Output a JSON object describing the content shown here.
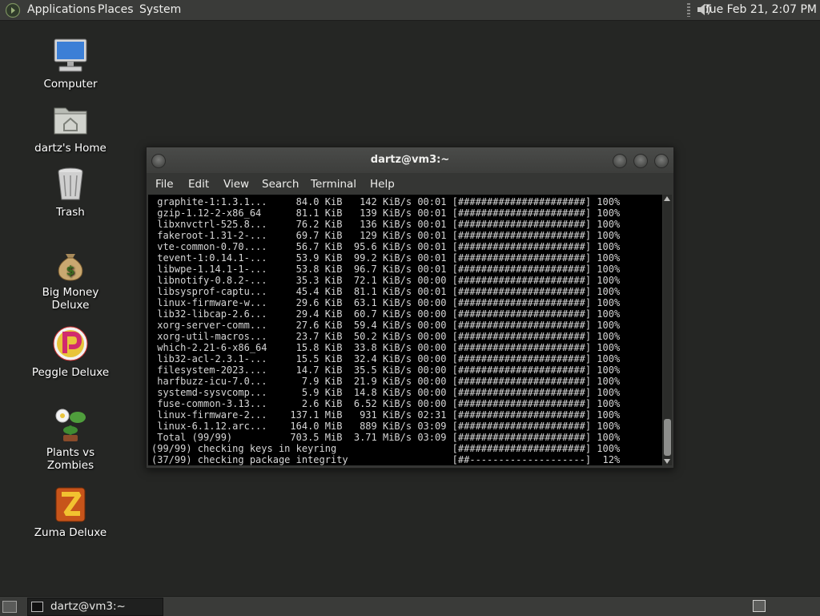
{
  "top_panel": {
    "menus": [
      "Applications",
      "Places",
      "System"
    ],
    "clock": "Tue Feb 21,  2:07 PM"
  },
  "desktop_icons": [
    {
      "label": "Computer",
      "icon": "computer-icon"
    },
    {
      "label": "dartz's Home",
      "icon": "home-folder-icon"
    },
    {
      "label": "Trash",
      "icon": "trash-icon"
    },
    {
      "label": "Big Money Deluxe",
      "icon": "money-bag-icon"
    },
    {
      "label": "Peggle Deluxe",
      "icon": "peggle-icon"
    },
    {
      "label": "Plants vs Zombies",
      "icon": "plants-vs-zombies-icon"
    },
    {
      "label": "Zuma Deluxe",
      "icon": "zuma-icon"
    }
  ],
  "terminal": {
    "title": "dartz@vm3:~",
    "menu": [
      "File",
      "Edit",
      "View",
      "Search",
      "Terminal",
      "Help"
    ],
    "lines": [
      " graphite-1:1.3.1...     84.0 KiB   142 KiB/s 00:01 [######################] 100%",
      " gzip-1.12-2-x86_64      81.1 KiB   139 KiB/s 00:01 [######################] 100%",
      " libxnvctrl-525.8...     76.2 KiB   136 KiB/s 00:01 [######################] 100%",
      " fakeroot-1.31-2-...     69.7 KiB   129 KiB/s 00:01 [######################] 100%",
      " vte-common-0.70....     56.7 KiB  95.6 KiB/s 00:01 [######################] 100%",
      " tevent-1:0.14.1-...     53.9 KiB  99.2 KiB/s 00:01 [######################] 100%",
      " libwpe-1.14.1-1-...     53.8 KiB  96.7 KiB/s 00:01 [######################] 100%",
      " libnotify-0.8.2-...     35.3 KiB  72.1 KiB/s 00:00 [######################] 100%",
      " libsysprof-captu...     45.4 KiB  81.1 KiB/s 00:01 [######################] 100%",
      " linux-firmware-w...     29.6 KiB  63.1 KiB/s 00:00 [######################] 100%",
      " lib32-libcap-2.6...     29.4 KiB  60.7 KiB/s 00:00 [######################] 100%",
      " xorg-server-comm...     27.6 KiB  59.4 KiB/s 00:00 [######################] 100%",
      " xorg-util-macros...     23.7 KiB  50.2 KiB/s 00:00 [######################] 100%",
      " which-2.21-6-x86_64     15.8 KiB  33.8 KiB/s 00:00 [######################] 100%",
      " lib32-acl-2.3.1-...     15.5 KiB  32.4 KiB/s 00:00 [######################] 100%",
      " filesystem-2023....     14.7 KiB  35.5 KiB/s 00:00 [######################] 100%",
      " harfbuzz-icu-7.0...      7.9 KiB  21.9 KiB/s 00:00 [######################] 100%",
      " systemd-sysvcomp...      5.9 KiB  14.8 KiB/s 00:00 [######################] 100%",
      " fuse-common-3.13...      2.6 KiB  6.52 KiB/s 00:00 [######################] 100%",
      " linux-firmware-2...    137.1 MiB   931 KiB/s 02:31 [######################] 100%",
      " linux-6.1.12.arc...    164.0 MiB   889 KiB/s 03:09 [######################] 100%",
      " Total (99/99)          703.5 MiB  3.71 MiB/s 03:09 [######################] 100%",
      "(99/99) checking keys in keyring                    [######################] 100%",
      "(37/99) checking package integrity                  [##--------------------]  12%"
    ]
  },
  "taskbar": {
    "tasks": [
      {
        "label": "dartz@vm3:~"
      }
    ]
  }
}
